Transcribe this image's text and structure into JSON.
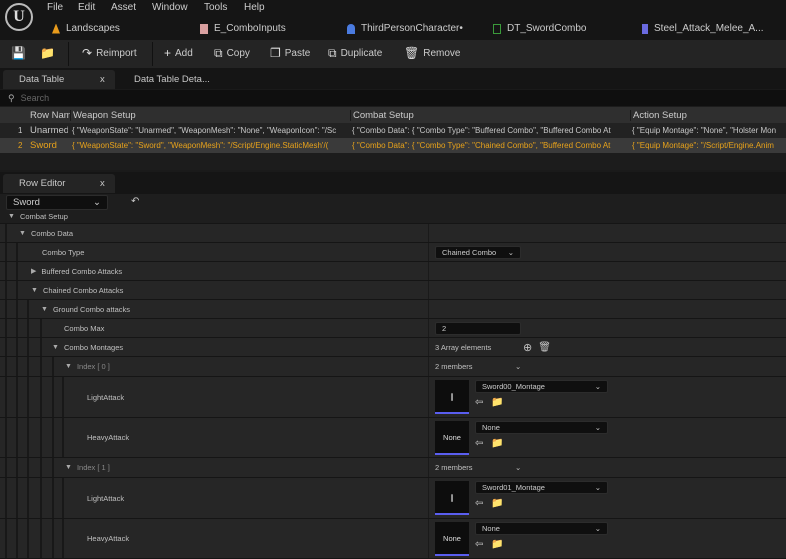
{
  "menu": [
    "File",
    "Edit",
    "Asset",
    "Window",
    "Tools",
    "Help"
  ],
  "asset_tabs": [
    {
      "label": "Landscapes",
      "icon": "landscape-icon",
      "color": "#e89b1c"
    },
    {
      "label": "E_ComboInputs",
      "icon": "enum-icon",
      "color": "#d9a0a0"
    },
    {
      "label": "ThirdPersonCharacter•",
      "icon": "blueprint-character-icon",
      "color": "#4a7be0"
    },
    {
      "label": "DT_SwordCombo",
      "icon": "datatable-icon",
      "color": "#3a9a3a"
    },
    {
      "label": "Steel_Attack_Melee_A...",
      "icon": "animation-icon",
      "color": "#6a6ae0"
    }
  ],
  "toolbar": {
    "reimport": "Reimport",
    "add": "Add",
    "copy": "Copy",
    "paste": "Paste",
    "duplicate": "Duplicate",
    "remove": "Remove"
  },
  "doc_tabs": {
    "data_table": "Data Table",
    "close": "x",
    "details": "Data Table Deta..."
  },
  "search": {
    "placeholder": "Search"
  },
  "table": {
    "headers": [
      "Row Nam",
      "Weapon Setup",
      "Combat Setup",
      "Action Setup"
    ],
    "rows": [
      {
        "index": "1",
        "name": "Unarmed",
        "weapon": "{ \"WeaponState\": \"Unarmed\", \"WeaponMesh\": \"None\", \"WeaponIcon\": \"/Sc",
        "combat": "{ \"Combo Data\": { \"Combo Type\": \"Buffered Combo\", \"Buffered Combo At",
        "action": "{ \"Equip Montage\": \"None\", \"Holster Mon"
      },
      {
        "index": "2",
        "name": "Sword",
        "weapon": "{ \"WeaponState\": \"Sword\", \"WeaponMesh\": \"/Script/Engine.StaticMesh'/(",
        "combat": "{ \"Combo Data\": { \"Combo Type\": \"Chained Combo\", \"Buffered Combo At",
        "action": "{ \"Equip Montage\": \"/Script/Engine.Anim"
      }
    ],
    "selected_row": 2,
    "selected_color": "#e7a21b"
  },
  "row_editor": {
    "tab": "Row Editor",
    "close": "x",
    "row_select": "Sword",
    "combat_setup": "Combat Setup",
    "combo_data": "Combo Data",
    "combo_type_label": "Combo Type",
    "combo_type_value": "Chained Combo",
    "buffered": "Buffered Combo Attacks",
    "chained": "Chained Combo Attacks",
    "ground": "Ground Combo attacks",
    "combo_max_label": "Combo Max",
    "combo_max_value": "2",
    "montages_label": "Combo Montages",
    "montages_value": "3 Array elements",
    "indices": [
      {
        "label": "Index [ 0 ]",
        "members": "2 members",
        "light_label": "LightAttack",
        "light_value": "Sword00_Montage",
        "heavy_label": "HeavyAttack",
        "heavy_value": "None",
        "heavy_thumb": "None"
      },
      {
        "label": "Index [ 1 ]",
        "members": "2 members",
        "light_label": "LightAttack",
        "light_value": "Sword01_Montage",
        "heavy_label": "HeavyAttack",
        "heavy_value": "None",
        "heavy_thumb": "None"
      }
    ]
  }
}
